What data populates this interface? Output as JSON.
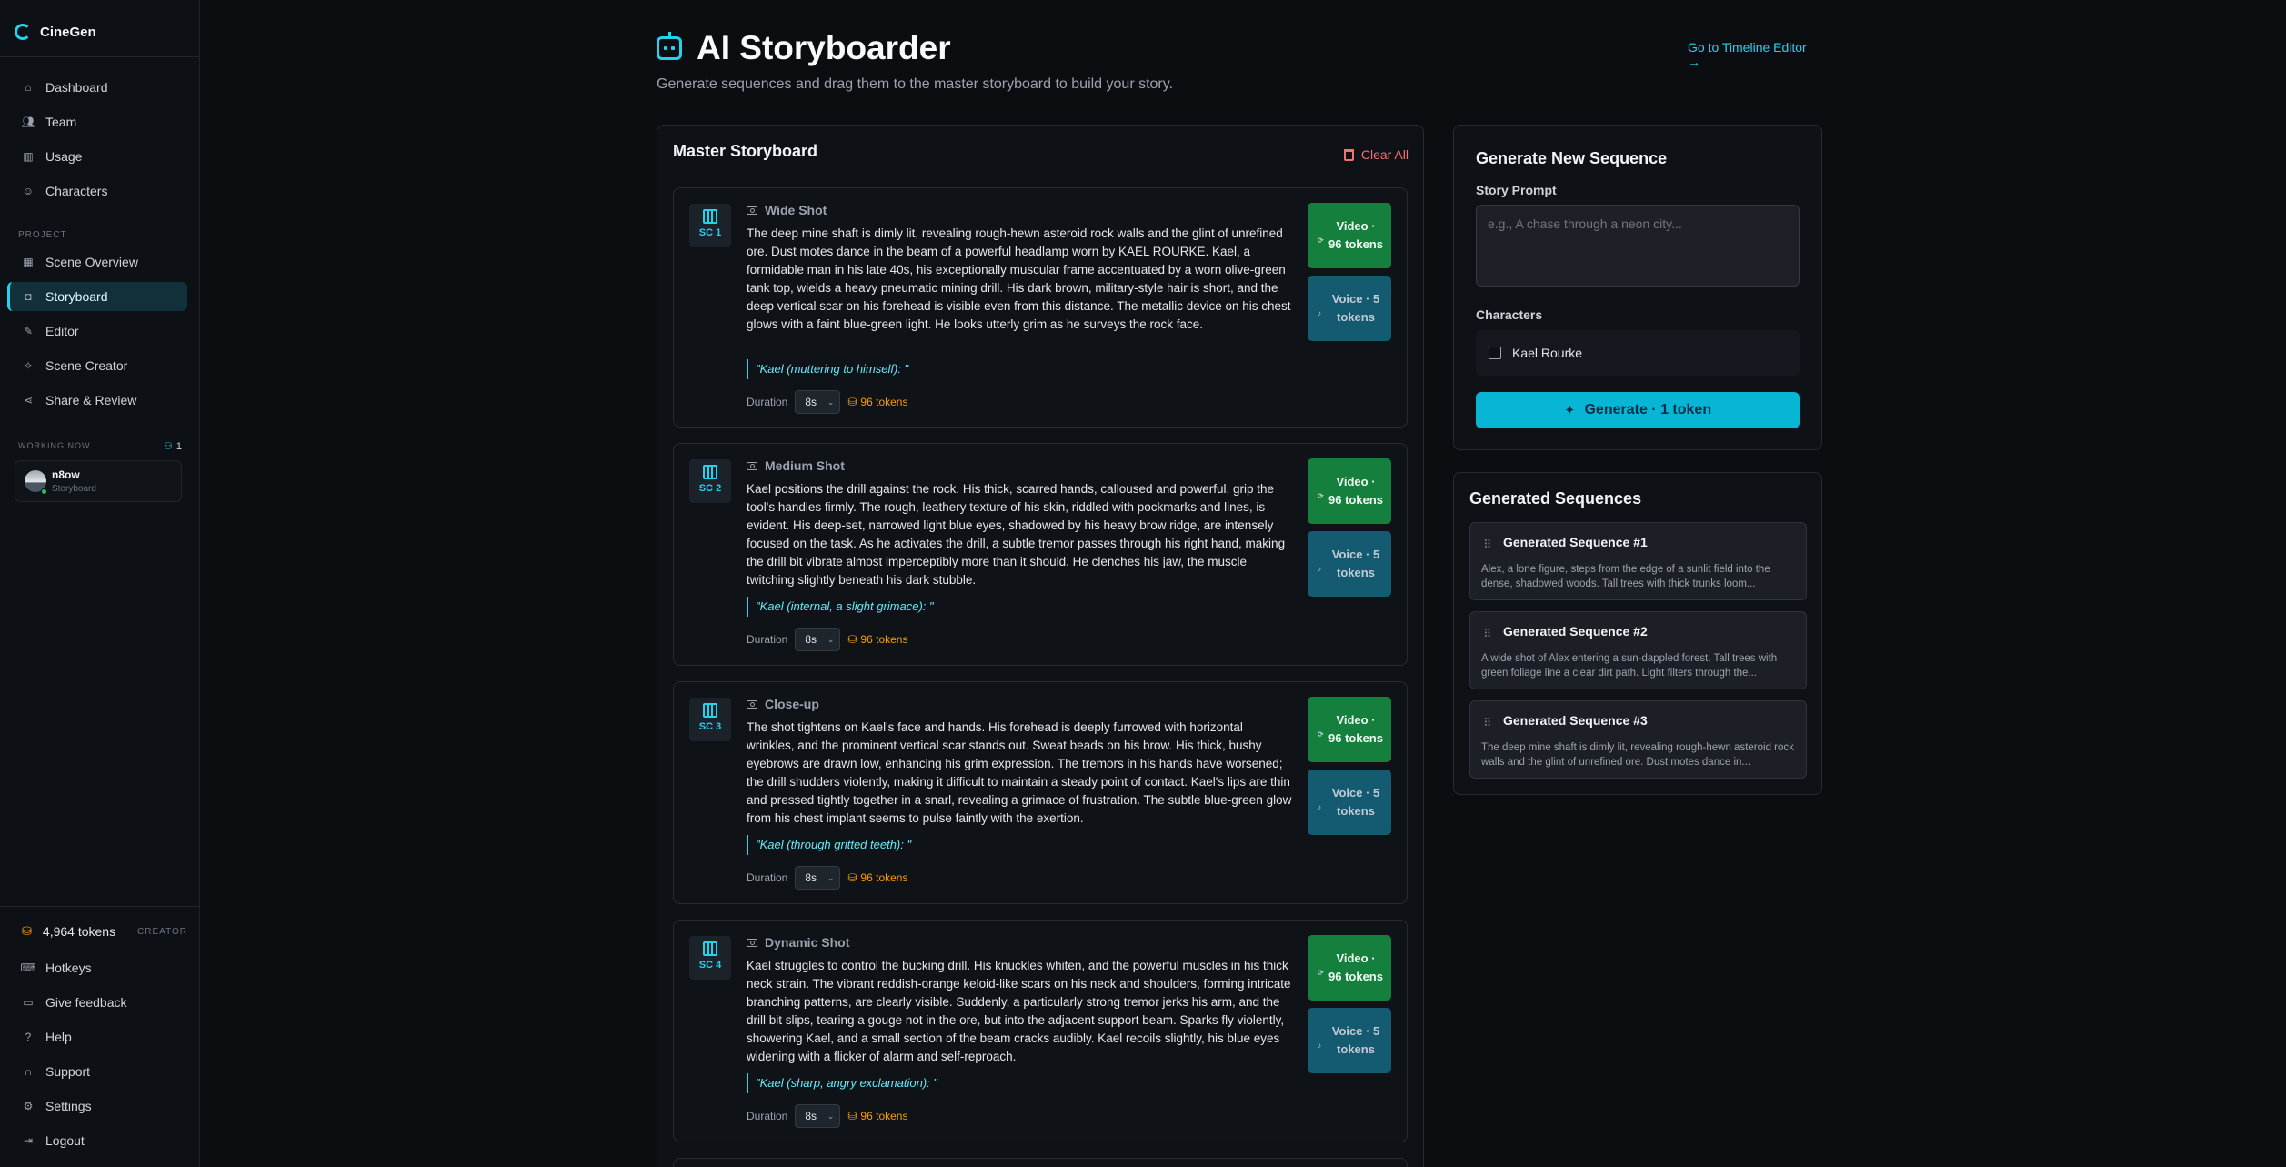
{
  "sidebar": {
    "brand": "CineGen",
    "nav_top": [
      {
        "label": "Dashboard",
        "icon": "home-icon"
      },
      {
        "label": "Team",
        "icon": "users-icon"
      },
      {
        "label": "Usage",
        "icon": "bar-chart-icon"
      },
      {
        "label": "Characters",
        "icon": "user-icon"
      }
    ],
    "project_label": "PROJECT",
    "nav_project": [
      {
        "label": "Scene Overview",
        "icon": "grid-icon"
      },
      {
        "label": "Storyboard",
        "icon": "bot-icon",
        "active": true
      },
      {
        "label": "Editor",
        "icon": "edit-icon"
      },
      {
        "label": "Scene Creator",
        "icon": "wand-icon"
      },
      {
        "label": "Share & Review",
        "icon": "share-icon"
      }
    ],
    "working_now_label": "WORKING NOW",
    "working_now_count": "1",
    "user": {
      "name": "n8ow",
      "location": "Storyboard"
    },
    "tokens": "4,964 tokens",
    "tier": "CREATOR",
    "nav_bottom": [
      {
        "label": "Hotkeys",
        "icon": "keyboard-icon"
      },
      {
        "label": "Give feedback",
        "icon": "message-icon"
      },
      {
        "label": "Help",
        "icon": "help-icon"
      },
      {
        "label": "Support",
        "icon": "headset-icon"
      },
      {
        "label": "Settings",
        "icon": "gear-icon"
      },
      {
        "label": "Logout",
        "icon": "logout-icon"
      }
    ]
  },
  "header": {
    "title": "AI Storyboarder",
    "subtitle": "Generate sequences and drag them to the master storyboard to build your story.",
    "timeline_link": "Go to Timeline Editor →"
  },
  "master": {
    "title": "Master Storyboard",
    "clear_all": "Clear All",
    "duration_label": "Duration",
    "scenes": [
      {
        "sc": "SC 1",
        "shot": "Wide Shot",
        "desc": "The deep mine shaft is dimly lit, revealing rough-hewn asteroid rock walls and the glint of unrefined ore. Dust motes dance in the beam of a powerful headlamp worn by KAEL ROURKE. Kael, a formidable man in his late 40s, his exceptionally muscular frame accentuated by a worn olive-green tank top, wields a heavy pneumatic mining drill. His dark brown, military-style hair is short, and the deep vertical scar on his forehead is visible even from this distance. The metallic device on his chest glows with a faint blue-green light. He looks utterly grim as he surveys the rock face.",
        "dialogue": "\"Kael (muttering to himself): \"",
        "duration": "8s",
        "cost": "96 tokens",
        "video": "Video · 96 tokens",
        "voice": "Voice · 5 tokens"
      },
      {
        "sc": "SC 2",
        "shot": "Medium Shot",
        "desc": "Kael positions the drill against the rock. His thick, scarred hands, calloused and powerful, grip the tool's handles firmly. The rough, leathery texture of his skin, riddled with pockmarks and lines, is evident. His deep-set, narrowed light blue eyes, shadowed by his heavy brow ridge, are intensely focused on the task. As he activates the drill, a subtle tremor passes through his right hand, making the drill bit vibrate almost imperceptibly more than it should. He clenches his jaw, the muscle twitching slightly beneath his dark stubble.",
        "dialogue": "\"Kael (internal, a slight grimace): \"",
        "duration": "8s",
        "cost": "96 tokens",
        "video": "Video · 96 tokens",
        "voice": "Voice · 5 tokens"
      },
      {
        "sc": "SC 3",
        "shot": "Close-up",
        "desc": "The shot tightens on Kael's face and hands. His forehead is deeply furrowed with horizontal wrinkles, and the prominent vertical scar stands out. Sweat beads on his brow. His thick, bushy eyebrows are drawn low, enhancing his grim expression. The tremors in his hands have worsened; the drill shudders violently, making it difficult to maintain a steady point of contact. Kael's lips are thin and pressed tightly together in a snarl, revealing a grimace of frustration. The subtle blue-green glow from his chest implant seems to pulse faintly with the exertion.",
        "dialogue": "\"Kael (through gritted teeth): \"",
        "duration": "8s",
        "cost": "96 tokens",
        "video": "Video · 96 tokens",
        "voice": "Voice · 5 tokens"
      },
      {
        "sc": "SC 4",
        "shot": "Dynamic Shot",
        "desc": "Kael struggles to control the bucking drill. His knuckles whiten, and the powerful muscles in his thick neck strain. The vibrant reddish-orange keloid-like scars on his neck and shoulders, forming intricate branching patterns, are clearly visible. Suddenly, a particularly strong tremor jerks his arm, and the drill bit slips, tearing a gouge not in the ore, but into the adjacent support beam. Sparks fly violently, showering Kael, and a small section of the beam cracks audibly. Kael recoils slightly, his blue eyes widening with a flicker of alarm and self-reproach.",
        "dialogue": "\"Kael (sharp, angry exclamation): \"",
        "duration": "8s",
        "cost": "96 tokens",
        "video": "Video · 96 tokens",
        "voice": "Voice · 5 tokens"
      }
    ]
  },
  "generator": {
    "title": "Generate New Sequence",
    "prompt_label": "Story Prompt",
    "prompt_placeholder": "e.g., A chase through a neon city...",
    "characters_label": "Characters",
    "character": "Kael Rourke",
    "generate": "Generate · 1 token"
  },
  "sequences": {
    "title": "Generated Sequences",
    "items": [
      {
        "name": "Generated Sequence #1",
        "desc": "Alex, a lone figure, steps from the edge of a sunlit field into the dense, shadowed woods. Tall trees with thick trunks loom..."
      },
      {
        "name": "Generated Sequence #2",
        "desc": "A wide shot of Alex entering a sun-dappled forest. Tall trees with green foliage line a clear dirt path. Light filters through the..."
      },
      {
        "name": "Generated Sequence #3",
        "desc": "The deep mine shaft is dimly lit, revealing rough-hewn asteroid rock walls and the glint of unrefined ore. Dust motes dance in..."
      }
    ]
  },
  "colors": {
    "accent": "#22d3ee",
    "video": "#15803d",
    "voice": "#155e75",
    "danger": "#f87171",
    "tokens": "#f59e0b"
  }
}
